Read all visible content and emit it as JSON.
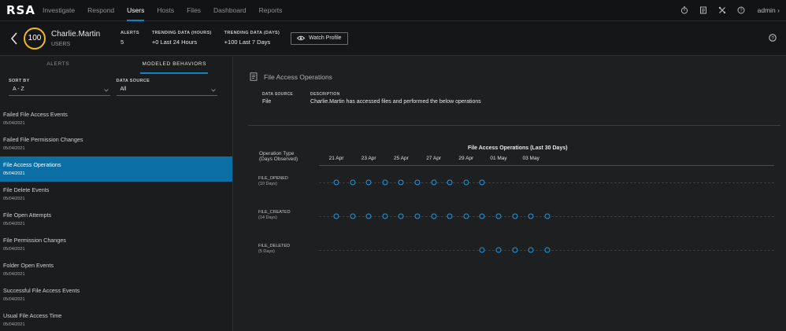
{
  "app": {
    "logo": "RSA",
    "admin_label": "admin",
    "admin_chevron": "›"
  },
  "nav": {
    "items": [
      {
        "label": "Investigate",
        "active": false
      },
      {
        "label": "Respond",
        "active": false
      },
      {
        "label": "Users",
        "active": true
      },
      {
        "label": "Hosts",
        "active": false
      },
      {
        "label": "Files",
        "active": false
      },
      {
        "label": "Dashboard",
        "active": false
      },
      {
        "label": "Reports",
        "active": false
      }
    ],
    "right_icons": [
      "timer-icon",
      "notes-icon",
      "tools-icon",
      "help-circle-icon"
    ]
  },
  "header": {
    "score": "100",
    "user_name": "Charlie.Martin",
    "entity_type": "USERS",
    "alerts_label": "ALERTS",
    "alerts_value": "5",
    "trend_hours_label": "TRENDING DATA (HOURS)",
    "trend_hours_value": "+0  Last 24 Hours",
    "trend_days_label": "TRENDING DATA (DAYS)",
    "trend_days_value": "+100  Last 7 Days",
    "watch_label": "Watch Profile",
    "score_color": "#f1b824"
  },
  "left": {
    "tabs": [
      {
        "label": "ALERTS",
        "active": false
      },
      {
        "label": "MODELED BEHAVIORS",
        "active": true
      }
    ],
    "sort_by_label": "SORT BY",
    "sort_by_value": "A - Z",
    "data_source_label": "DATA SOURCE",
    "data_source_value": "All",
    "behaviors": [
      {
        "name": "Failed File Access Events",
        "date": "05/04/2021",
        "selected": false
      },
      {
        "name": "Failed File Permission Changes",
        "date": "05/04/2021",
        "selected": false
      },
      {
        "name": "File Access Operations",
        "date": "05/04/2021",
        "selected": true
      },
      {
        "name": "File Delete Events",
        "date": "05/04/2021",
        "selected": false
      },
      {
        "name": "File Open Attempts",
        "date": "05/04/2021",
        "selected": false
      },
      {
        "name": "File Permission Changes",
        "date": "05/04/2021",
        "selected": false
      },
      {
        "name": "Folder Open Events",
        "date": "05/04/2021",
        "selected": false
      },
      {
        "name": "Successful File Access Events",
        "date": "05/04/2021",
        "selected": false
      },
      {
        "name": "Usual File Access Time",
        "date": "05/04/2021",
        "selected": false
      }
    ]
  },
  "detail": {
    "title": "File Access Operations",
    "data_source_label": "DATA SOURCE",
    "data_source_value": "File",
    "description_label": "DESCRIPTION",
    "description_value": "Charlie.Martin has accessed files and performed the below operations"
  },
  "chart_data": {
    "type": "scatter",
    "title": "File Access Operations (Last 30 Days)",
    "ylabel_line1": "Operation Type",
    "ylabel_line2": "(Days Observed)",
    "x_ticks": [
      "21 Apr",
      "23 Apr",
      "25 Apr",
      "27 Apr",
      "29 Apr",
      "01 May",
      "03 May"
    ],
    "x_range": [
      "2021-04-21",
      "2021-05-04"
    ],
    "accent_color": "#1e9be8",
    "series": [
      {
        "name": "FILE_OPENED",
        "days_label": "(10 Days)",
        "x": [
          "2021-04-21",
          "2021-04-22",
          "2021-04-23",
          "2021-04-24",
          "2021-04-25",
          "2021-04-26",
          "2021-04-27",
          "2021-04-28",
          "2021-04-29",
          "2021-04-30"
        ]
      },
      {
        "name": "FILE_CREATED",
        "days_label": "(14 Days)",
        "x": [
          "2021-04-21",
          "2021-04-22",
          "2021-04-23",
          "2021-04-24",
          "2021-04-25",
          "2021-04-26",
          "2021-04-27",
          "2021-04-28",
          "2021-04-29",
          "2021-04-30",
          "2021-05-01",
          "2021-05-02",
          "2021-05-03",
          "2021-05-04"
        ]
      },
      {
        "name": "FILE_DELETED",
        "days_label": "(5 Days)",
        "x": [
          "2021-04-30",
          "2021-05-01",
          "2021-05-02",
          "2021-05-03",
          "2021-05-04"
        ]
      }
    ]
  }
}
